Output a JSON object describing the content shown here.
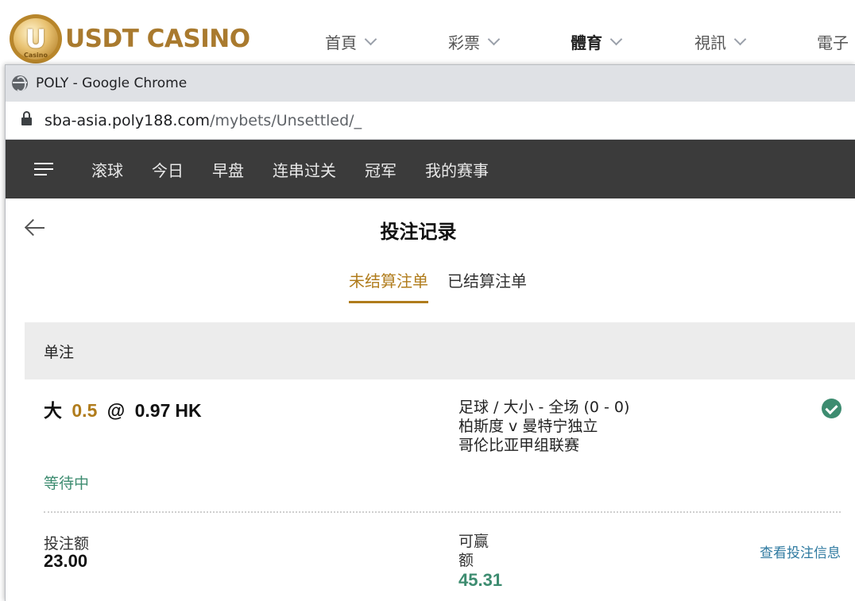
{
  "site": {
    "logo_letter": "U",
    "logo_small_text": "Casino",
    "logo_text": "USDT CASINO",
    "nav": [
      {
        "label": "首頁",
        "active": false
      },
      {
        "label": "彩票",
        "active": false
      },
      {
        "label": "體育",
        "active": true
      },
      {
        "label": "視訊",
        "active": false
      },
      {
        "label": "電子",
        "active": false
      }
    ]
  },
  "window": {
    "title": "POLY - Google Chrome",
    "icon": "globe-icon",
    "url_host": "sba-asia.poly188.com",
    "url_path": "/mybets/Unsettled/_"
  },
  "app_nav": {
    "menu_icon": "hamburger-menu-icon",
    "tabs": [
      "滚球",
      "今日",
      "早盘",
      "连串过关",
      "冠军",
      "我的赛事"
    ]
  },
  "page": {
    "title": "投注记录",
    "tabs": [
      {
        "label": "未结算注单",
        "active": true
      },
      {
        "label": "已结算注单",
        "active": false
      }
    ],
    "section_label": "单注"
  },
  "bet": {
    "selection": "大",
    "handicap": "0.5",
    "at": "@",
    "odds": "0.97",
    "odds_type": "HK",
    "sport_market": "足球 / 大小 - 全场 (0 - 0)",
    "match": "柏斯度 v 曼特宁独立",
    "league": "哥伦比亚甲组联赛",
    "status": "等待中",
    "stake_label": "投注额",
    "stake": "23.00",
    "win_label": "可赢额",
    "win_amount": "45.31",
    "view_link": "查看投注信息"
  },
  "colors": {
    "accent_gold": "#b07c1c",
    "status_green": "#3d8c70",
    "link_blue": "#2f7aa0",
    "nav_bg": "#3b3b3b"
  }
}
